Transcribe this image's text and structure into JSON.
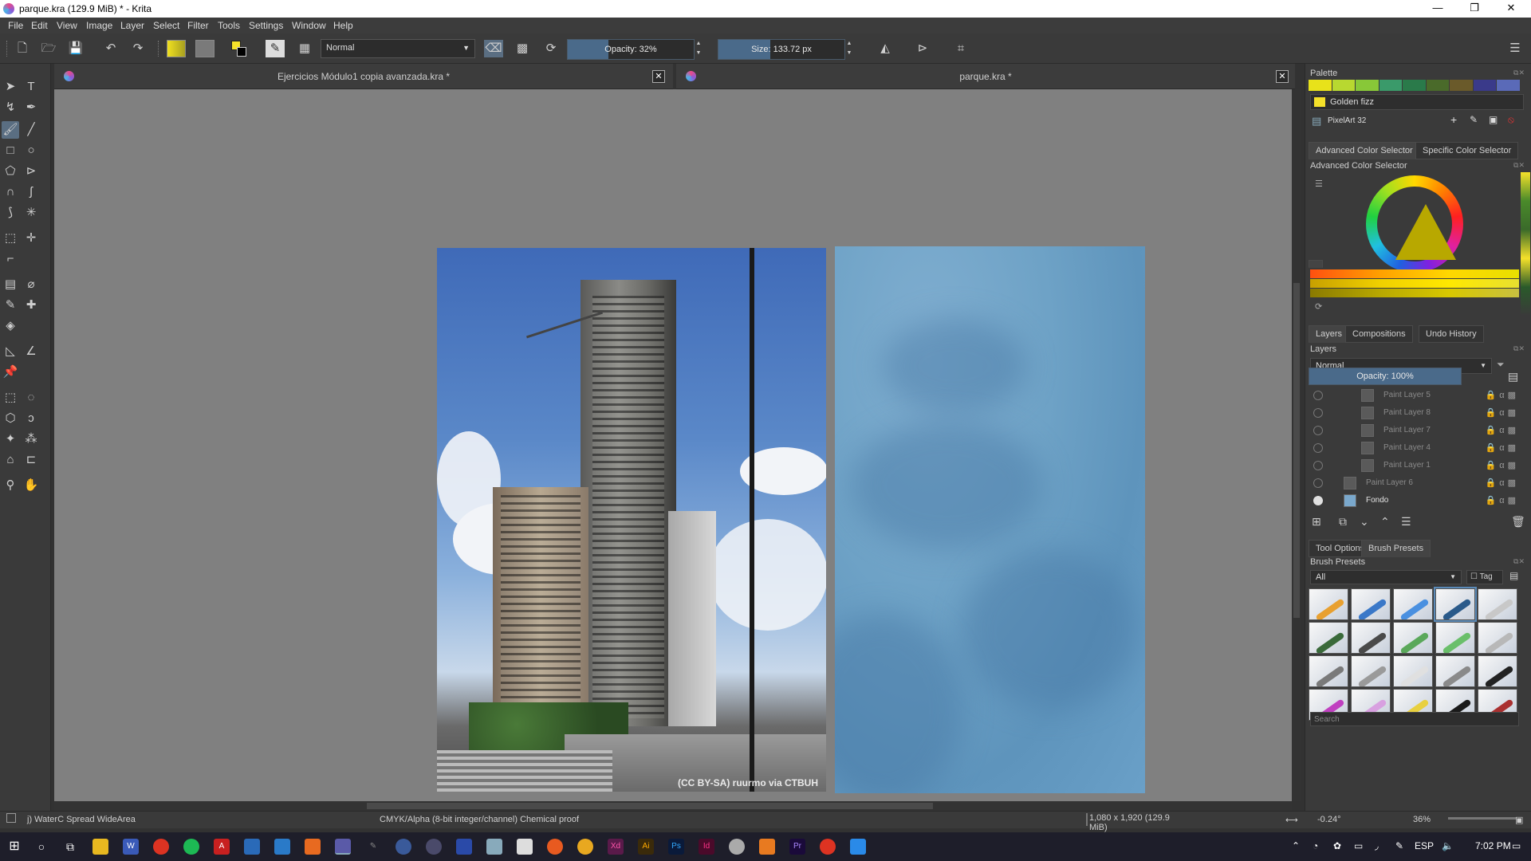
{
  "window": {
    "title": "parque.kra (129.9 MiB)  * - Krita",
    "controls": [
      "—",
      "❐",
      "✕"
    ]
  },
  "menu": [
    "File",
    "Edit",
    "View",
    "Image",
    "Layer",
    "Select",
    "Filter",
    "Tools",
    "Settings",
    "Window",
    "Help"
  ],
  "toolbar": {
    "blend_mode": "Normal",
    "opacity_label": "Opacity: 32%",
    "opacity_value": 0.32,
    "size_label": "Size: 133.72 px",
    "size_value": 133.72
  },
  "tabs": [
    {
      "title": "Ejercicios Módulo1 copia avanzada.kra *"
    },
    {
      "title": "parque.kra *"
    }
  ],
  "canvas": {
    "photo_credit": "(CC BY-SA) ruurmo via CTBUH"
  },
  "palette": {
    "title": "Palette",
    "colors": [
      "#e8e21a",
      "#b8d830",
      "#88c838",
      "#3a9a6a",
      "#2a7a4a",
      "#4a6a2a",
      "#6a5a2a",
      "#3a3a8a",
      "#5a6ab8"
    ],
    "selected_color_name": "Golden fizz",
    "selected_color": "#f5e12a",
    "palette_name": "PixelArt 32"
  },
  "color_selector": {
    "tabs": [
      "Advanced Color Selector",
      "Specific Color Selector"
    ],
    "title": "Advanced Color Selector"
  },
  "layers_panel": {
    "tabs": [
      "Layers",
      "Compositions",
      "Undo History"
    ],
    "title": "Layers",
    "blend_mode": "Normal",
    "opacity_label": "Opacity:  100%",
    "opacity_value": 1.0,
    "layers": [
      {
        "name": "Paint Layer 5",
        "visible": false
      },
      {
        "name": "Paint Layer 8",
        "visible": false
      },
      {
        "name": "Paint Layer 7",
        "visible": false
      },
      {
        "name": "Paint Layer 4",
        "visible": false
      },
      {
        "name": "Paint Layer 1",
        "visible": false
      },
      {
        "name": "Paint Layer 6",
        "visible": false
      },
      {
        "name": "Fondo",
        "visible": true
      }
    ]
  },
  "brush_panel": {
    "tabs": [
      "Tool Options",
      "Brush Presets"
    ],
    "title": "Brush Presets",
    "filter": "All",
    "tag_label": "Tag",
    "search_placeholder": "Search"
  },
  "statusbar": {
    "brush": "j) WaterC Spread WideArea",
    "color_space": "CMYK/Alpha (8-bit integer/channel)  Chemical proof",
    "dimensions": "1,080 x 1,920 (129.9 MiB)",
    "rotation": "-0.24°",
    "zoom": "36%"
  },
  "taskbar": {
    "lang": "ESP",
    "time": "7:02 PM"
  }
}
